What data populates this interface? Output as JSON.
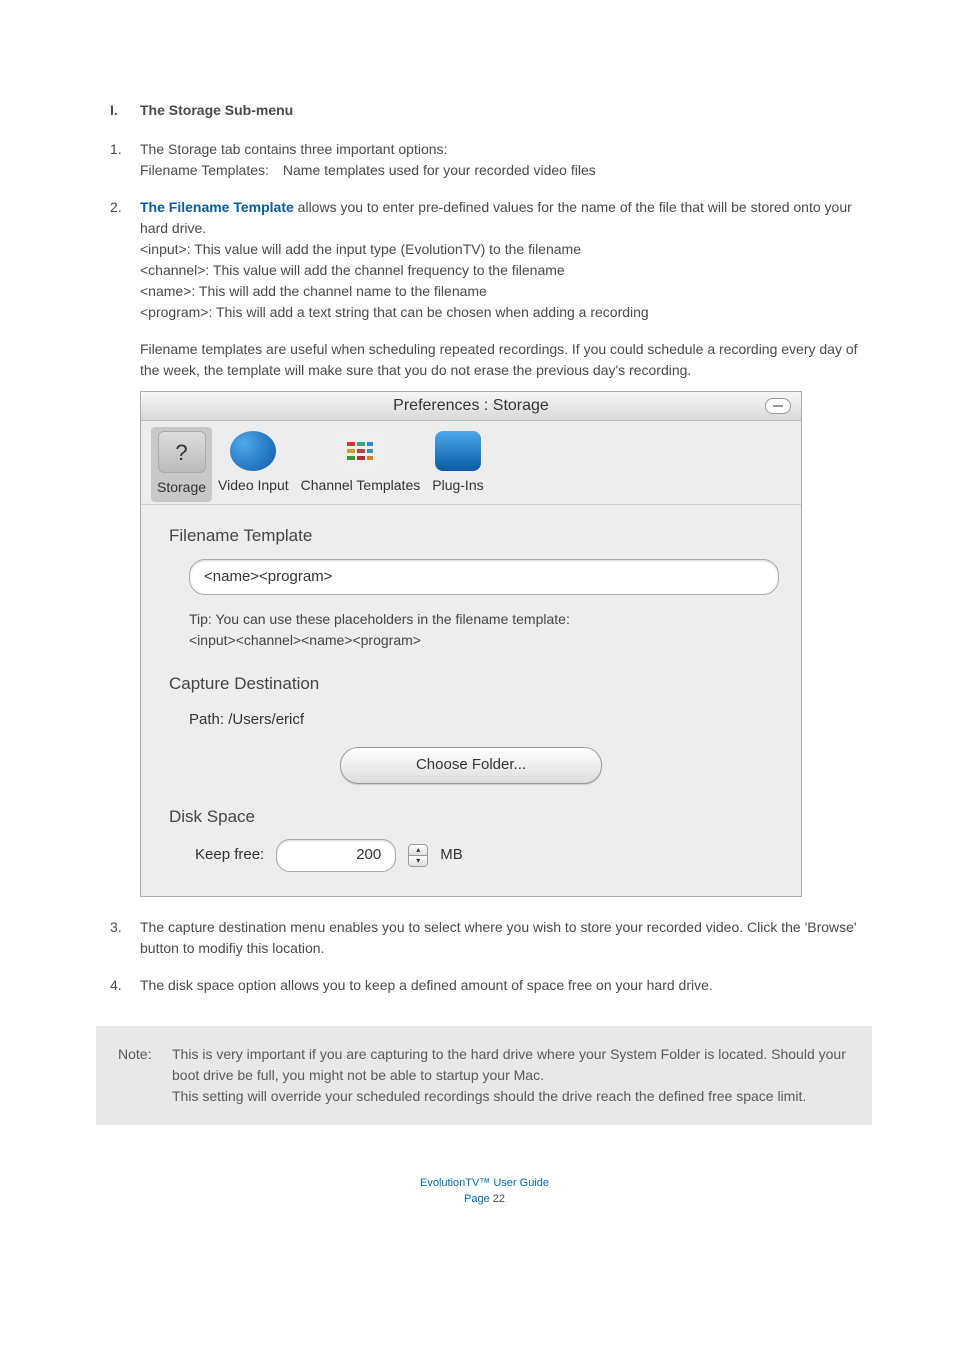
{
  "section": {
    "marker": "I.",
    "title": "The Storage Sub-menu"
  },
  "items": [
    {
      "num": "1.",
      "lines": [
        "The Storage tab contains three important options:",
        "Filename Templates: Name templates used for your recorded video files"
      ]
    },
    {
      "num": "2.",
      "bold_lead": "The Filename Template",
      "after_bold": " allows you to enter pre-defined values for the name of the file that will be stored onto your hard drive.",
      "lines": [
        "<input>: This value will add the input type (EvolutionTV) to the filename",
        "<channel>: This value will add the channel frequency to the filename",
        "<name>: This will add the channel name to the filename",
        "<program>: This will add a text string that can be chosen when adding a recording"
      ],
      "para_after": "Filename templates are useful when scheduling repeated recordings. If you could schedule a recording every day of the week, the template will make sure that you do not erase the previous day's recording."
    },
    {
      "num": "3.",
      "lines": [
        "The capture destination menu enables you to select where you wish to store your recorded video. Click the 'Browse' button to modifiy this location."
      ]
    },
    {
      "num": "4.",
      "lines": [
        "The disk space option allows you to keep a defined amount of space free on your hard drive."
      ]
    }
  ],
  "prefs": {
    "window_title": "Preferences : Storage",
    "tabs": {
      "storage": "Storage",
      "video_input": "Video Input",
      "channel_templates": "Channel Templates",
      "plug_ins": "Plug-Ins"
    },
    "section_filename": "Filename Template",
    "filename_value": "<name><program>",
    "tip_line1": "Tip: You can use these placeholders in the filename template:",
    "tip_line2": "<input><channel><name><program>",
    "section_capture": "Capture Destination",
    "path_label": "Path:",
    "path_value": "/Users/ericf",
    "choose_folder": "Choose Folder...",
    "section_disk": "Disk Space",
    "keep_free_label": "Keep free:",
    "keep_free_value": "200",
    "keep_free_unit": "MB"
  },
  "note": {
    "label": "Note:",
    "body": "This is very important if you are capturing to the hard drive where your System Folder is located. Should your boot drive be full, you might not be able to startup your Mac.\nThis setting will override your scheduled recordings should the drive reach the defined free space limit."
  },
  "footer": {
    "title": "EvolutionTV™ User Guide",
    "page_label": "Page ",
    "page": "22"
  }
}
